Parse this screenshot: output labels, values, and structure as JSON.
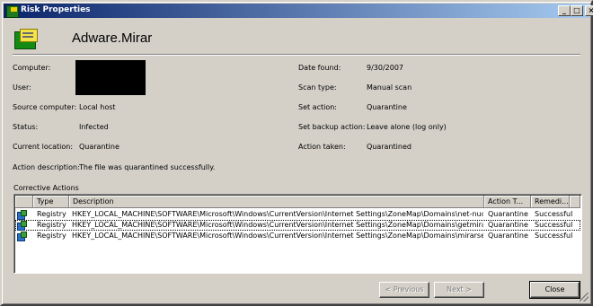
{
  "window": {
    "title": "Risk Properties",
    "controls": {
      "minimize": "_",
      "maximize": "□",
      "close": "×"
    }
  },
  "header": {
    "risk_name": "Adware.Mirar"
  },
  "details": {
    "computer_label": "Computer:",
    "user_label": "User:",
    "source_computer_label": "Source computer:",
    "source_computer": "Local host",
    "status_label": "Status:",
    "status": "Infected",
    "current_location_label": "Current location:",
    "current_location": "Quarantine",
    "action_description_label": "Action description:",
    "action_description": "The file was quarantined successfully.",
    "date_found_label": "Date found:",
    "date_found": "9/30/2007",
    "scan_type_label": "Scan type:",
    "scan_type": "Manual scan",
    "set_action_label": "Set action:",
    "set_action": "Quarantine",
    "set_backup_action_label": "Set backup action:",
    "set_backup_action": "Leave alone (log only)",
    "action_taken_label": "Action taken:",
    "action_taken": "Quarantined"
  },
  "corrective_actions": {
    "label": "Corrective Actions",
    "columns": [
      "",
      "Type",
      "Description",
      "Action T...",
      "Remedi..."
    ],
    "rows": [
      {
        "type": "Registry",
        "description": "HKEY_LOCAL_MACHINE\\SOFTWARE\\Microsoft\\Windows\\CurrentVersion\\Internet Settings\\ZoneMap\\Domains\\net-nucleus.com",
        "action": "Quarantine",
        "remediation": "Successful"
      },
      {
        "type": "Registry",
        "description": "HKEY_LOCAL_MACHINE\\SOFTWARE\\Microsoft\\Windows\\CurrentVersion\\Internet Settings\\ZoneMap\\Domains\\getmirar.com",
        "action": "Quarantine",
        "remediation": "Successful"
      },
      {
        "type": "Registry",
        "description": "HKEY_LOCAL_MACHINE\\SOFTWARE\\Microsoft\\Windows\\CurrentVersion\\Internet Settings\\ZoneMap\\Domains\\mirarsearch.com",
        "action": "Quarantine",
        "remediation": "Successful"
      }
    ]
  },
  "buttons": {
    "previous": "< Previous",
    "next": "Next >",
    "close": "Close"
  }
}
